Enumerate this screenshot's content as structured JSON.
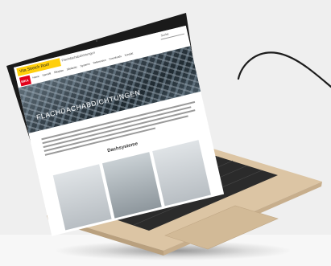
{
  "site": {
    "brand_title": "Vita Stretch Roof",
    "tagline": "Flachdachabdichtungen",
    "search_label": "Suche",
    "logo_text": "SIKA",
    "nav_items": [
      "Home",
      "Sarnafil",
      "Sikaplan",
      "Sikalastic",
      "Systeme",
      "Referenzen",
      "Downloads",
      "Kontakt"
    ],
    "hero_title": "FLACHDACHABDICHTUNGEN",
    "section_heading": "Dachsysteme"
  },
  "colors": {
    "brand_yellow": "#ffcf0c",
    "brand_red": "#e2001a",
    "laptop_gold": "#d9c3a3"
  }
}
